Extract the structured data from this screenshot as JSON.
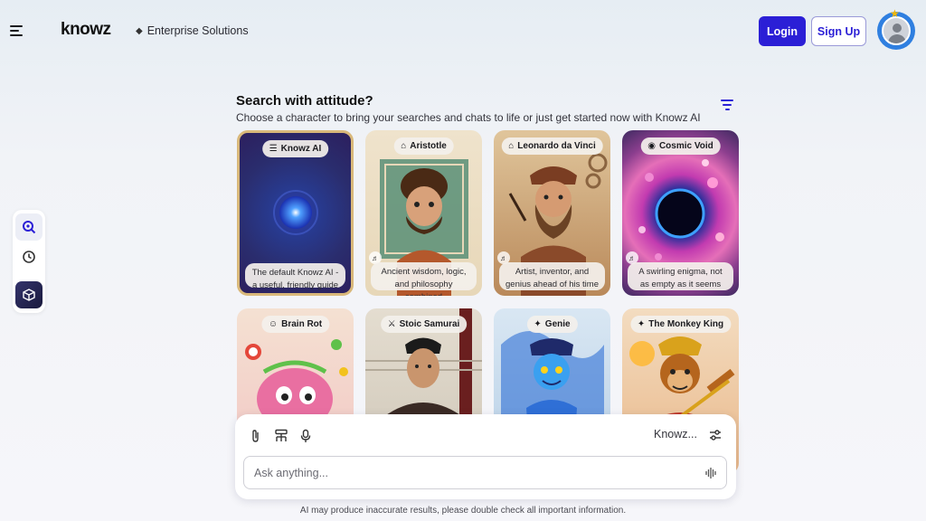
{
  "header": {
    "logo": "knowz",
    "enterprise_label": "Enterprise Solutions",
    "login_label": "Login",
    "signup_label": "Sign Up"
  },
  "main": {
    "title": "Search with attitude?",
    "subtitle": "Choose a character to bring your searches and chats to life or just get started now with Knowz AI"
  },
  "characters": [
    {
      "name": "Knowz AI",
      "description": "The default Knowz AI - a useful, friendly guide",
      "icon": "book-icon",
      "selected": true
    },
    {
      "name": "Aristotle",
      "description": "Ancient wisdom, logic, and philosophy combined",
      "icon": "columns-icon"
    },
    {
      "name": "Leonardo da Vinci",
      "description": "Artist, inventor, and genius ahead of his time",
      "icon": "columns-icon"
    },
    {
      "name": "Cosmic Void",
      "description": "A swirling enigma, not as empty as it seems",
      "icon": "planet-icon"
    },
    {
      "name": "Brain Rot",
      "description": "",
      "icon": "smiley-icon"
    },
    {
      "name": "Stoic Samurai",
      "description": "",
      "icon": "swords-icon"
    },
    {
      "name": "Genie",
      "description": "",
      "icon": "sparkle-icon"
    },
    {
      "name": "The Monkey King",
      "description": "",
      "icon": "sparkle-icon"
    }
  ],
  "composer": {
    "model_label": "Knowz...",
    "placeholder": "Ask anything..."
  },
  "footer": {
    "disclaimer": "AI may produce inaccurate results, please double check all important information."
  },
  "colors": {
    "accent": "#2b1fd6",
    "avatar_ring": "#2f7fe0"
  }
}
